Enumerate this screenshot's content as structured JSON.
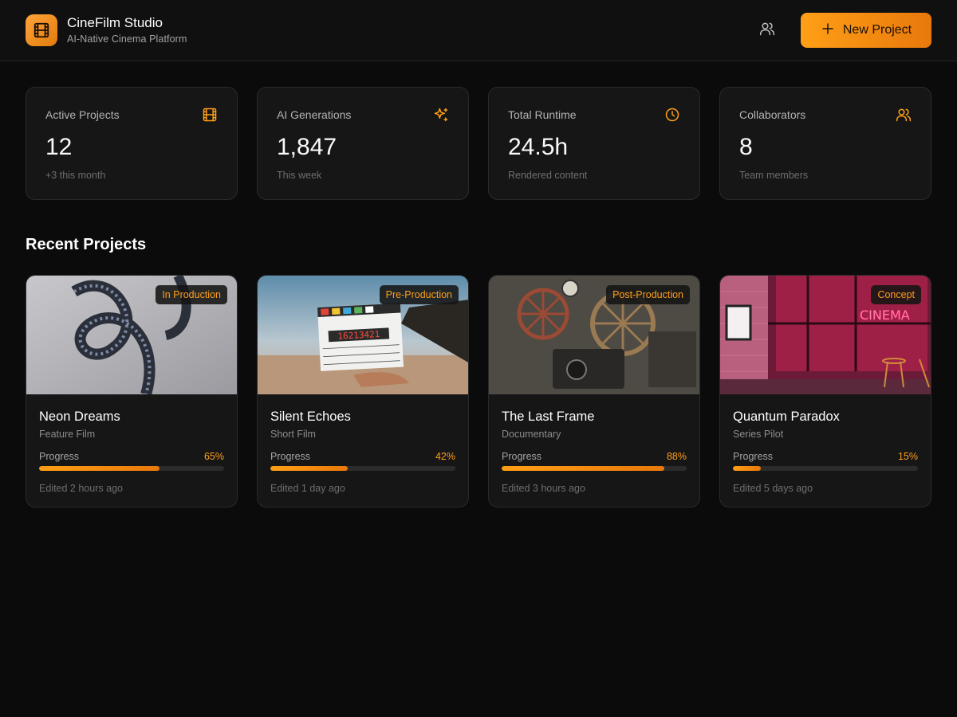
{
  "app": {
    "title": "CineFilm Studio",
    "subtitle": "AI-Native Cinema Platform",
    "logo_icon": "film-icon",
    "accent_color": "#ff9f16"
  },
  "header": {
    "collaborators_icon": "users-icon",
    "new_project_label": "New Project",
    "new_project_icon": "plus-icon"
  },
  "stats": [
    {
      "label": "Active Projects",
      "value": "12",
      "sub": "+3 this month",
      "icon": "film-icon"
    },
    {
      "label": "AI Generations",
      "value": "1,847",
      "sub": "This week",
      "icon": "sparkles-icon"
    },
    {
      "label": "Total Runtime",
      "value": "24.5h",
      "sub": "Rendered content",
      "icon": "clock-icon"
    },
    {
      "label": "Collaborators",
      "value": "8",
      "sub": "Team members",
      "icon": "users-icon"
    }
  ],
  "recent": {
    "title": "Recent Projects",
    "progress_label": "Progress",
    "projects": [
      {
        "title": "Neon Dreams",
        "type": "Feature Film",
        "status": "In Production",
        "progress": 65,
        "progress_text": "65%",
        "edited": "Edited 2 hours ago",
        "image": "film-reel-strip"
      },
      {
        "title": "Silent Echoes",
        "type": "Short Film",
        "status": "Pre-Production",
        "progress": 42,
        "progress_text": "42%",
        "edited": "Edited 1 day ago",
        "image": "clapperboard-desert"
      },
      {
        "title": "The Last Frame",
        "type": "Documentary",
        "status": "Post-Production",
        "progress": 88,
        "progress_text": "88%",
        "edited": "Edited 3 hours ago",
        "image": "vintage-projector"
      },
      {
        "title": "Quantum Paradox",
        "type": "Series Pilot",
        "status": "Concept",
        "progress": 15,
        "progress_text": "15%",
        "edited": "Edited 5 days ago",
        "image": "neon-cinema-sign"
      }
    ]
  }
}
